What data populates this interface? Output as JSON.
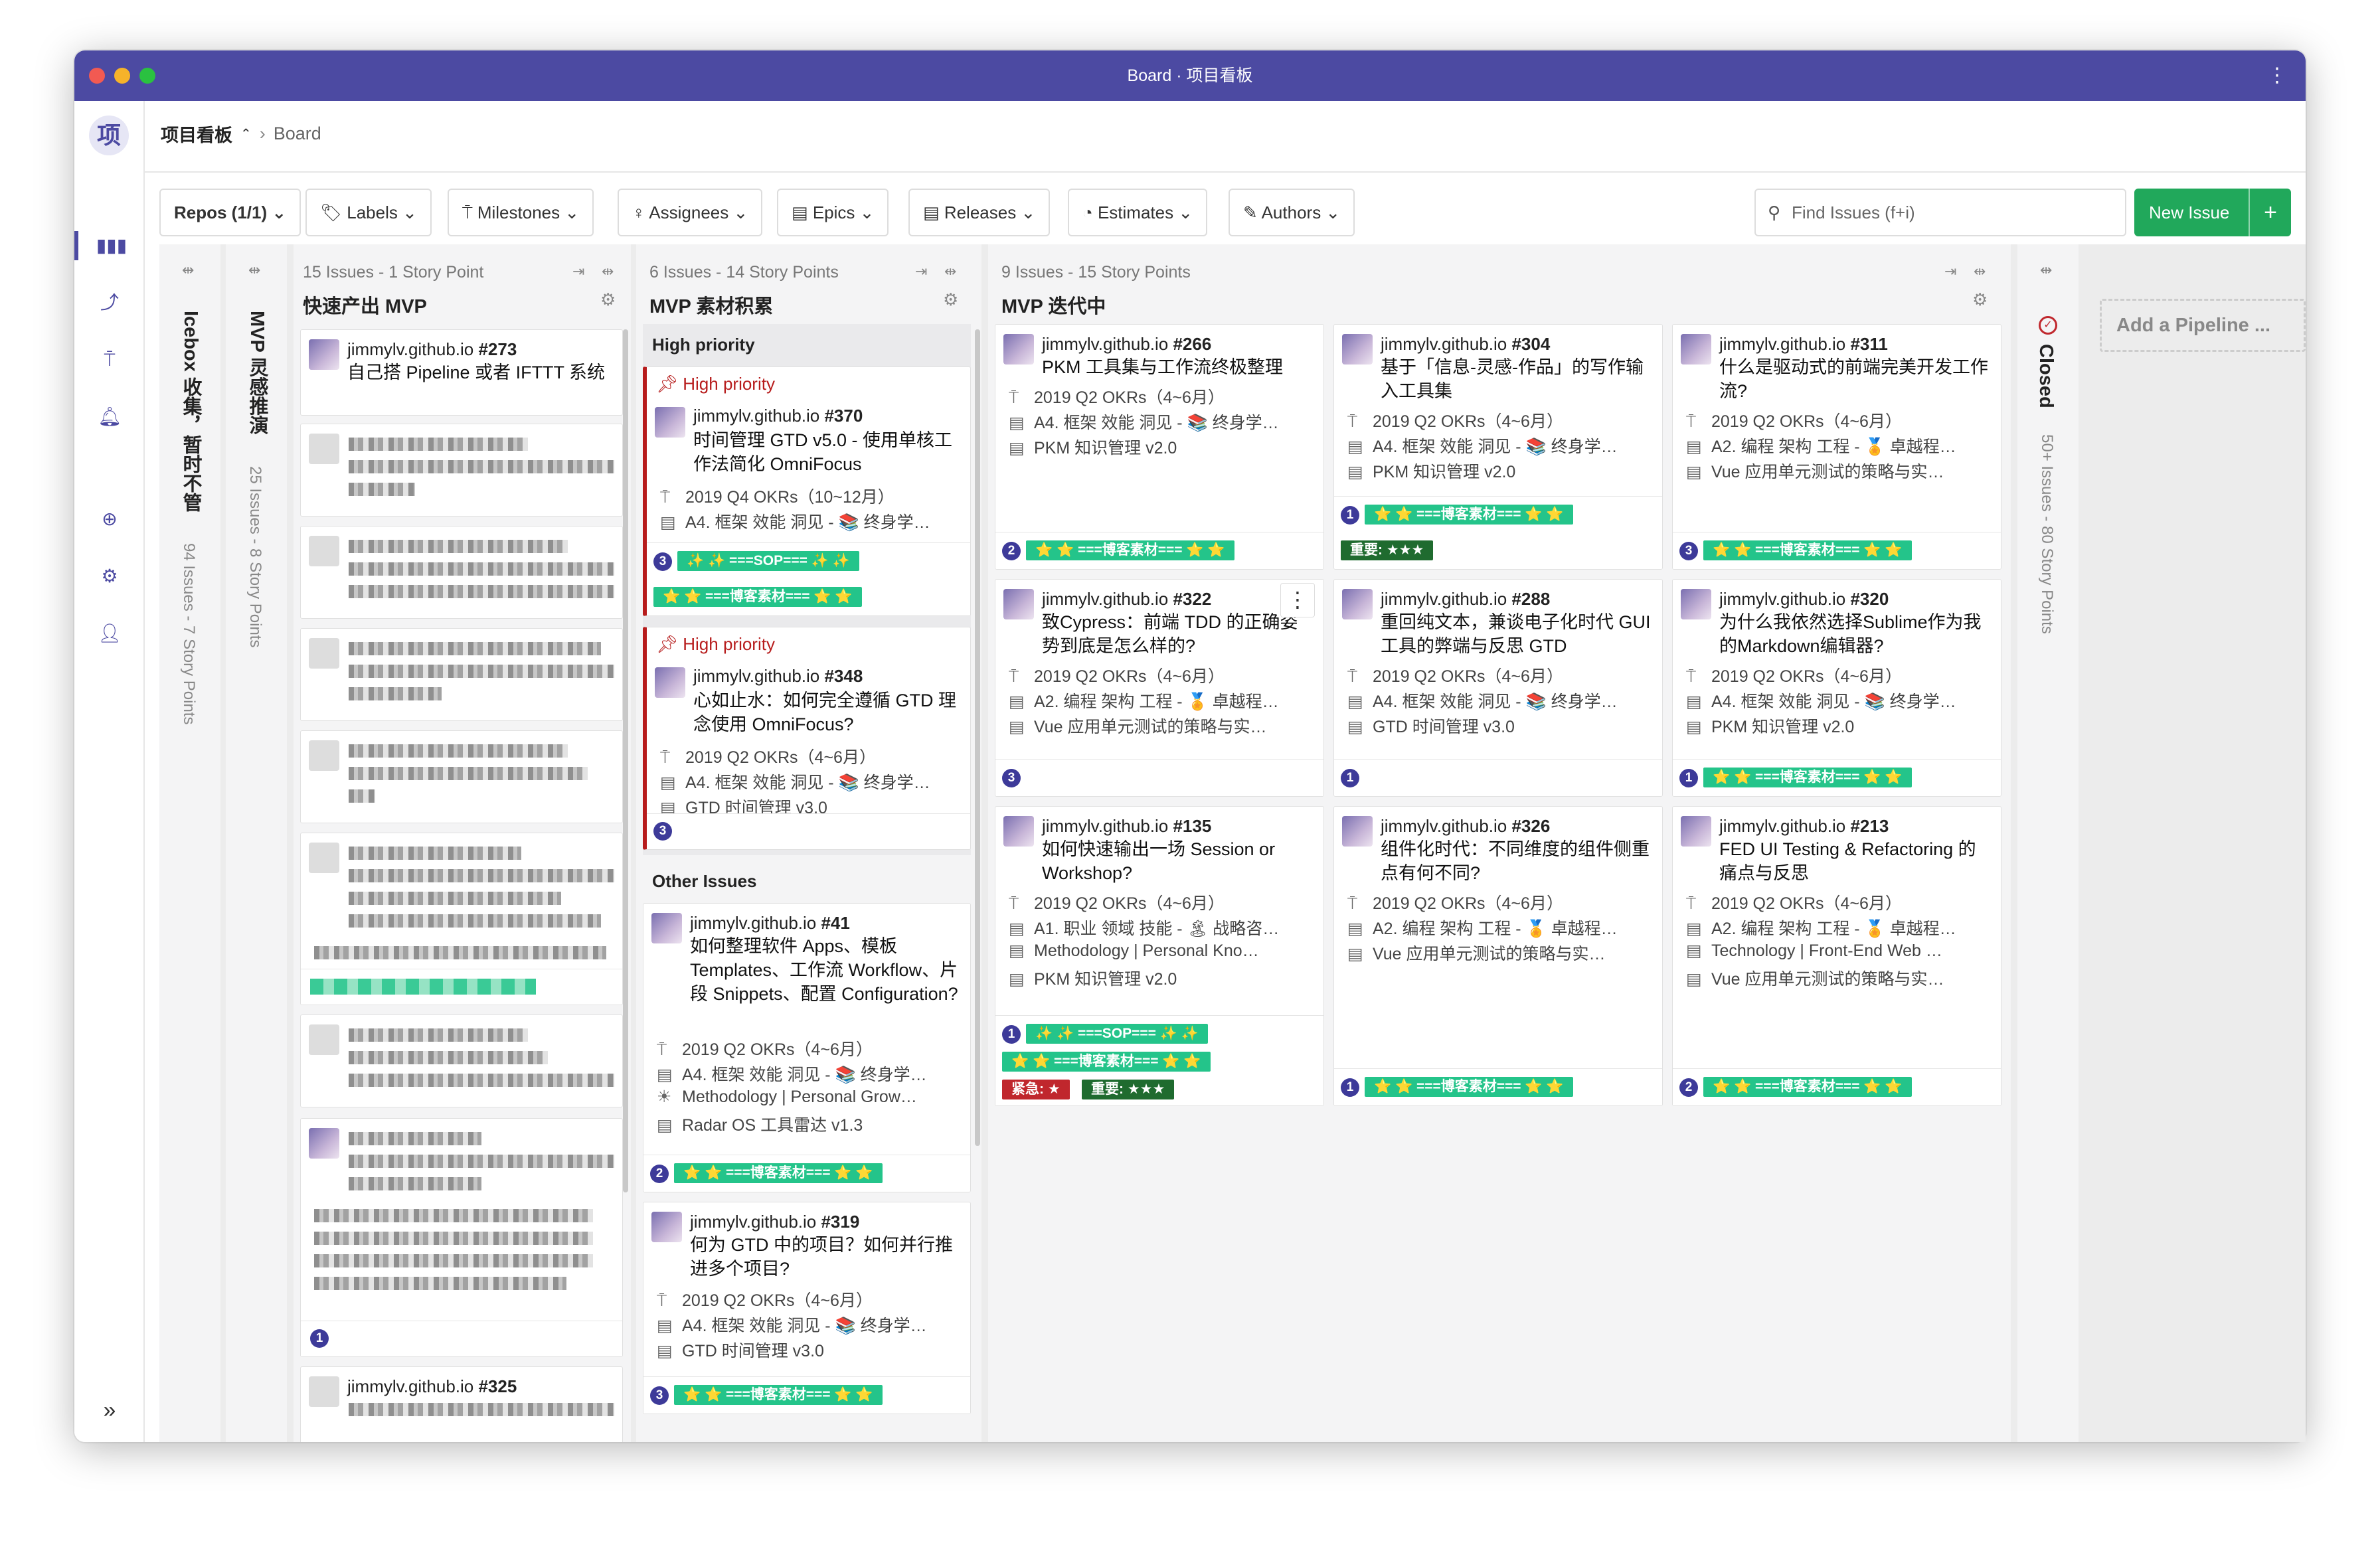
{
  "window": {
    "title": "Board · 项目看板",
    "dot_colors": [
      "#f25a52",
      "#f6b32a",
      "#2ac140"
    ]
  },
  "rail": {
    "logo": "项"
  },
  "breadcrumb": {
    "workspace": "项目看板",
    "page": "Board"
  },
  "filters": {
    "repos": "Repos (1/1)",
    "labels": "Labels",
    "milestones": "Milestones",
    "assignees": "Assignees",
    "epics": "Epics",
    "releases": "Releases",
    "estimates": "Estimates",
    "authors": "Authors"
  },
  "search": {
    "placeholder": "Find Issues (f+i)"
  },
  "new_issue": {
    "label": "New Issue",
    "plus": "+"
  },
  "collapsed": {
    "icebox": {
      "name": "Icebox 收集，暂时不管",
      "meta": "94 Issues - 7 Story Points"
    },
    "mvp_inspire": {
      "name": "MVP 灵感推演",
      "meta": "25 Issues - 8 Story Points"
    },
    "closed": {
      "name": "Closed",
      "meta": "50+ Issues - 80 Story Points"
    }
  },
  "add_pipeline": "Add a Pipeline ...",
  "columns": {
    "fast": {
      "meta": "15 Issues - 1 Story Point",
      "name": "快速产出 MVP",
      "card1": {
        "repo": "jimmylv.github.io ",
        "num": "#273",
        "title": "自己搭 Pipeline 或者 IFTTT 系统"
      },
      "last": {
        "repo": "jimmylv.github.io ",
        "num": "#325"
      }
    },
    "materials": {
      "meta": "6 Issues - 14 Story Points",
      "name": "MVP 素材积累",
      "high_section": "High priority",
      "other_section": "Other Issues",
      "c370": {
        "prio": "High priority",
        "repo": "jimmylv.github.io ",
        "num": "#370",
        "title": "时间管理 GTD v5.0 - 使用单核工作法简化 OmniFocus",
        "m1": "2019 Q4 OKRs（10~12月）",
        "m2": "A4. 框架 效能 洞见 - 📚 终身学…",
        "est": "3",
        "t1": "✨ ✨ ===SOP=== ✨ ✨",
        "t2": "⭐ ⭐ ===博客素材=== ⭐ ⭐"
      },
      "c348": {
        "prio": "High priority",
        "repo": "jimmylv.github.io ",
        "num": "#348",
        "title": "心如止水：如何完全遵循 GTD 理念使用 OmniFocus?",
        "m1": "2019 Q2 OKRs（4~6月）",
        "m2": "A4. 框架 效能 洞见 - 📚 终身学…",
        "m3": "GTD 时间管理 v3.0",
        "est": "3"
      },
      "c41": {
        "repo": "jimmylv.github.io ",
        "num": "#41",
        "title": "如何整理软件 Apps、模板 Templates、工作流 Workflow、片段 Snippets、配置 Configuration?",
        "m1": "2019 Q2 OKRs（4~6月）",
        "m2": "A4. 框架 效能 洞见 - 📚 终身学…",
        "m3": "Methodology | Personal Grow…",
        "m4": "Radar OS 工具雷达 v1.3",
        "est": "2",
        "t1": "⭐ ⭐ ===博客素材=== ⭐ ⭐"
      },
      "c319": {
        "repo": "jimmylv.github.io ",
        "num": "#319",
        "title": "何为 GTD 中的项目？如何并行推进多个项目?",
        "m1": "2019 Q2 OKRs（4~6月）",
        "m2": "A4. 框架 效能 洞见 - 📚 终身学…",
        "m3": "GTD 时间管理 v3.0",
        "est": "3",
        "t1": "⭐ ⭐ ===博客素材=== ⭐ ⭐"
      }
    },
    "iter": {
      "meta": "9 Issues - 15 Story Points",
      "name": "MVP 迭代中",
      "cards": [
        {
          "repo": "jimmylv.github.io ",
          "num": "#266",
          "title": "PKM 工具集与工作流终极整理",
          "m1": "2019 Q2 OKRs（4~6月）",
          "m2": "A4. 框架 效能 洞见 - 📚 终身学…",
          "m3": "PKM 知识管理 v2.0",
          "est": "2",
          "t1": "⭐ ⭐ ===博客素材=== ⭐ ⭐"
        },
        {
          "repo": "jimmylv.github.io ",
          "num": "#304",
          "title": "基于「信息-灵感-作品」的写作输入工具集",
          "m1": "2019 Q2 OKRs（4~6月）",
          "m2": "A4. 框架 效能 洞见 - 📚 终身学…",
          "m3": "PKM 知识管理 v2.0",
          "est": "1",
          "t1": "⭐ ⭐ ===博客素材=== ⭐ ⭐",
          "t2": "重要: ★★★"
        },
        {
          "repo": "jimmylv.github.io ",
          "num": "#311",
          "title": "什么是驱动式的前端完美开发工作流?",
          "m1": "2019 Q2 OKRs（4~6月）",
          "m2": "A2. 编程 架构 工程 - 🏅 卓越程…",
          "m3": "Vue 应用单元测试的策略与实…",
          "est": "3",
          "t1": "⭐ ⭐ ===博客素材=== ⭐ ⭐"
        },
        {
          "repo": "jimmylv.github.io ",
          "num": "#322",
          "title": "致Cypress：前端 TDD 的正确姿势到底是怎么样的?",
          "m1": "2019 Q2 OKRs（4~6月）",
          "m2": "A2. 编程 架构 工程 - 🏅 卓越程…",
          "m3": "Vue 应用单元测试的策略与实…",
          "est": "3"
        },
        {
          "repo": "jimmylv.github.io ",
          "num": "#288",
          "title": "重回纯文本，兼谈电子化时代 GUI 工具的弊端与反思 GTD",
          "m1": "2019 Q2 OKRs（4~6月）",
          "m2": "A4. 框架 效能 洞见 - 📚 终身学…",
          "m3": "GTD 时间管理 v3.0",
          "est": "1"
        },
        {
          "repo": "jimmylv.github.io ",
          "num": "#320",
          "title": "为什么我依然选择Sublime作为我的Markdown编辑器?",
          "m1": "2019 Q2 OKRs（4~6月）",
          "m2": "A4. 框架 效能 洞见 - 📚 终身学…",
          "m3": "PKM 知识管理 v2.0",
          "est": "1",
          "t1": "⭐ ⭐ ===博客素材=== ⭐ ⭐"
        },
        {
          "repo": "jimmylv.github.io ",
          "num": "#135",
          "title": "如何快速输出一场 Session or Workshop?",
          "m1": "2019 Q2 OKRs（4~6月）",
          "m2": "A1. 职业 领域 技能 - 🏝 战略咨…",
          "m3": "Methodology | Personal Kno…",
          "m4": "PKM 知识管理 v2.0",
          "est": "1",
          "t1": "✨ ✨ ===SOP=== ✨ ✨",
          "t2": "⭐ ⭐ ===博客素材=== ⭐ ⭐",
          "t3": "紧急: ★",
          "t4": "重要: ★★★"
        },
        {
          "repo": "jimmylv.github.io ",
          "num": "#326",
          "title": "组件化时代：不同维度的组件侧重点有何不同?",
          "m1": "2019 Q2 OKRs（4~6月）",
          "m2": "A2. 编程 架构 工程 - 🏅 卓越程…",
          "m3": "Vue 应用单元测试的策略与实…",
          "est": "1",
          "t1": "⭐ ⭐ ===博客素材=== ⭐ ⭐"
        },
        {
          "repo": "jimmylv.github.io ",
          "num": "#213",
          "title": "FED UI Testing & Refactoring 的痛点与反思",
          "m1": "2019 Q2 OKRs（4~6月）",
          "m2": "A2. 编程 架构 工程 - 🏅 卓越程…",
          "m3": "Technology | Front-End Web …",
          "m4": "Vue 应用单元测试的策略与实…",
          "est": "2",
          "t1": "⭐ ⭐ ===博客素材=== ⭐ ⭐"
        }
      ]
    }
  },
  "icons": {
    "milestone": "signpost-icon",
    "epic": "epic-icon",
    "release": "release-icon"
  }
}
